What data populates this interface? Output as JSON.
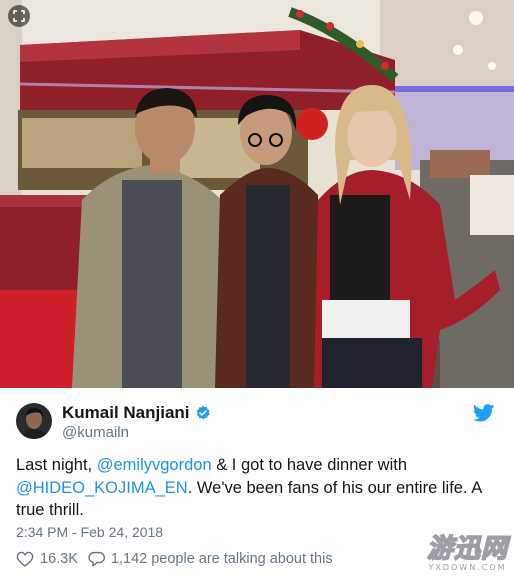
{
  "tweet": {
    "author_name": "Kumail Nanjiani",
    "author_handle": "@kumailn",
    "text_parts": {
      "p1": "Last night, ",
      "mention1": "@emilyvgordon",
      "p2": " & I got to have dinner with ",
      "mention2": "@HIDEO_KOJIMA_EN",
      "p3": ". We've been fans of his our entire life. A true thrill."
    },
    "timestamp": "2:34 PM - Feb 24, 2018",
    "likes": "16.3K",
    "replies_text": "1,142 people are talking about this"
  },
  "watermark": {
    "main": "游迅网",
    "sub": "YXDOWN.COM"
  },
  "icons": {
    "verified": "verified-badge-icon",
    "bird": "twitter-bird-icon",
    "heart": "heart-icon",
    "reply": "reply-bubble-icon",
    "expand": "expand-icon"
  },
  "colors": {
    "link": "#1b95e0",
    "secondary": "#657786",
    "primary": "#14171a",
    "brand": "#1da1f2"
  }
}
